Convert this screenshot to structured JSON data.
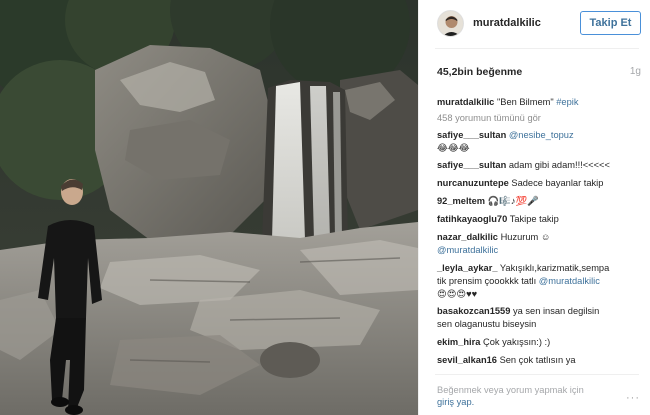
{
  "post": {
    "image_alt": "Man in black clothing standing on rocks in front of a waterfall"
  },
  "header": {
    "username": "muratdalkilic",
    "follow_label": "Takip Et"
  },
  "stats": {
    "likes": "45,2bin beğenme",
    "time": "1g"
  },
  "caption": {
    "user": "muratdalkilic",
    "text": "\"Ben Bilmem\"",
    "hashtag": "#epik"
  },
  "view_all": "458 yorumun tümünü gör",
  "comments": [
    {
      "user": "safiye___sultan",
      "mention": "@nesibe_topuz",
      "text": "",
      "line2": "😂😂😂"
    },
    {
      "user": "safiye___sultan",
      "text": "adam gibi adam!!!<<<<<"
    },
    {
      "user": "nurcanuzuntepe",
      "text": "Sadece bayanlar takip"
    },
    {
      "user": "92_meltem",
      "text": "🎧🎼♪💯🎤"
    },
    {
      "user": "fatihkayaoglu70",
      "text": "Takipe takip"
    },
    {
      "user": "nazar_dalkilic",
      "text": "Huzurum ☺",
      "line2_mention": "@muratdalkilic"
    },
    {
      "user": "_leyla_aykar_",
      "text": "Yakışıklı,karizmatik,sempa",
      "line2_text": "tik prensim çoookkk tatlı",
      "line2_mention": "@muratdalkilic",
      "line3": "😍😍😍♥♥"
    },
    {
      "user": "basakozcan1559",
      "text": "ya sen insan degilsin",
      "line2_text": "sen olaganustu biseysin"
    },
    {
      "user": "ekim_hira",
      "text": "Çok yakışsın:) :)"
    },
    {
      "user": "sevil_alkan16",
      "text": "Sen çok tatlısın ya"
    }
  ],
  "footer": {
    "prompt": "Beğenmek veya yorum yapmak için",
    "login": "giriş yap.",
    "more_icon": "···"
  }
}
